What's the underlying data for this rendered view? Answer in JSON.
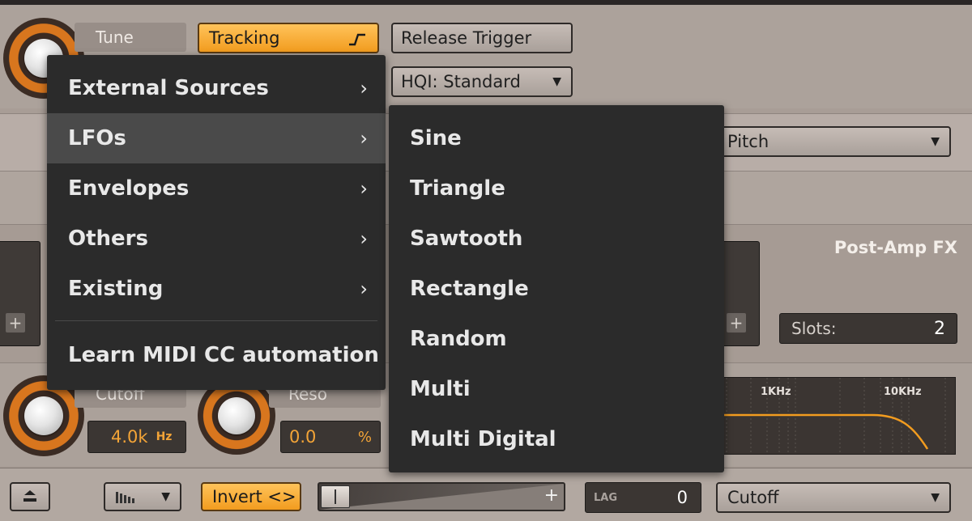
{
  "top_row": {
    "tune_label": "Tune",
    "tracking_label": "Tracking",
    "tracking_icon": "step-curve-icon",
    "release_trigger_label": "Release Trigger",
    "hqi_label": "HQI: Standard",
    "hqi_caret": "▼"
  },
  "mod_target": {
    "value": "Pitch",
    "caret": "▼"
  },
  "fx_panel": {
    "title": "Post-Amp FX",
    "slots_label": "Slots:",
    "slots_value": "2",
    "plus": "+"
  },
  "filter_row": {
    "cutoff_label": "Cutoff",
    "cutoff_value": "4.0k",
    "cutoff_unit": "Hz",
    "reso_label": "Reso",
    "reso_value": "0.0",
    "reso_unit": "%",
    "graph_labels": [
      "1KHz",
      "10KHz"
    ]
  },
  "bottom_bar": {
    "invert_label": "Invert <>",
    "slider_plus": "+",
    "lag_label": "LAG",
    "lag_value": "0",
    "target_value": "Cutoff",
    "target_caret": "▼",
    "curve_caret": "▼"
  },
  "menu": {
    "items": [
      {
        "label": "External Sources",
        "chevron": "›"
      },
      {
        "label": "LFOs",
        "chevron": "›"
      },
      {
        "label": "Envelopes",
        "chevron": "›"
      },
      {
        "label": "Others",
        "chevron": "›"
      },
      {
        "label": "Existing",
        "chevron": "›"
      }
    ],
    "learn_label": "Learn MIDI CC automation"
  },
  "submenu": {
    "items": [
      "Sine",
      "Triangle",
      "Sawtooth",
      "Rectangle",
      "Random",
      "Multi",
      "Multi Digital"
    ]
  },
  "colors": {
    "accent": "#f29c1f",
    "menu_bg": "#2b2b2b",
    "menu_active": "#4a4a4a",
    "panel_bg": "#a89d96"
  }
}
